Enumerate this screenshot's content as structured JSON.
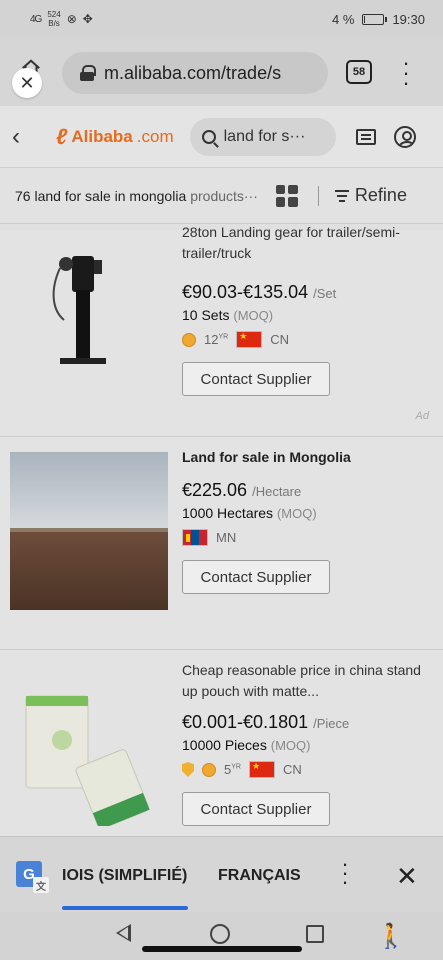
{
  "status_bar": {
    "signal": "4G",
    "net_speed_value": "524",
    "net_speed_unit": "B/s",
    "battery_level_percent": 4,
    "battery": "4 %",
    "time": "19:30"
  },
  "browser": {
    "url": "m.alibaba.com/trade/s",
    "tab_count": "58"
  },
  "site": {
    "logo_text": "Alibaba",
    "logo_suffix": ".com",
    "search_value": "land for s···"
  },
  "results": {
    "count": "76",
    "query": "land for sale in mongolia",
    "suffix": "products···",
    "refine_label": "Refine"
  },
  "products": [
    {
      "title": "28ton Landing gear for trailer/semi-trailer/truck",
      "price": "€90.03-€135.04",
      "unit": "/Set",
      "moq_qty": "10 Sets",
      "moq_label": "(MOQ)",
      "years": "12",
      "years_sup": "YR",
      "country": "CN",
      "contact_label": "Contact Supplier",
      "ad_label": "Ad"
    },
    {
      "title": "Land for sale in Mongolia",
      "price": "€225.06",
      "unit": "/Hectare",
      "moq_qty": "1000 Hectares",
      "moq_label": "(MOQ)",
      "country": "MN",
      "contact_label": "Contact Supplier"
    },
    {
      "title": "Cheap reasonable price in china stand up pouch with matte...",
      "price": "€0.001-€0.1801",
      "unit": "/Piece",
      "moq_qty": "10000 Pieces",
      "moq_label": "(MOQ)",
      "years": "5",
      "years_sup": "YR",
      "country": "CN",
      "contact_label": "Contact Supplier"
    }
  ],
  "translate": {
    "source_lang": "IOIS (SIMPLIFIÉ)",
    "target_lang": "FRANÇAIS"
  },
  "colors": {
    "brand_orange": "#e56b1f",
    "translate_accent": "#2a6ad8"
  }
}
